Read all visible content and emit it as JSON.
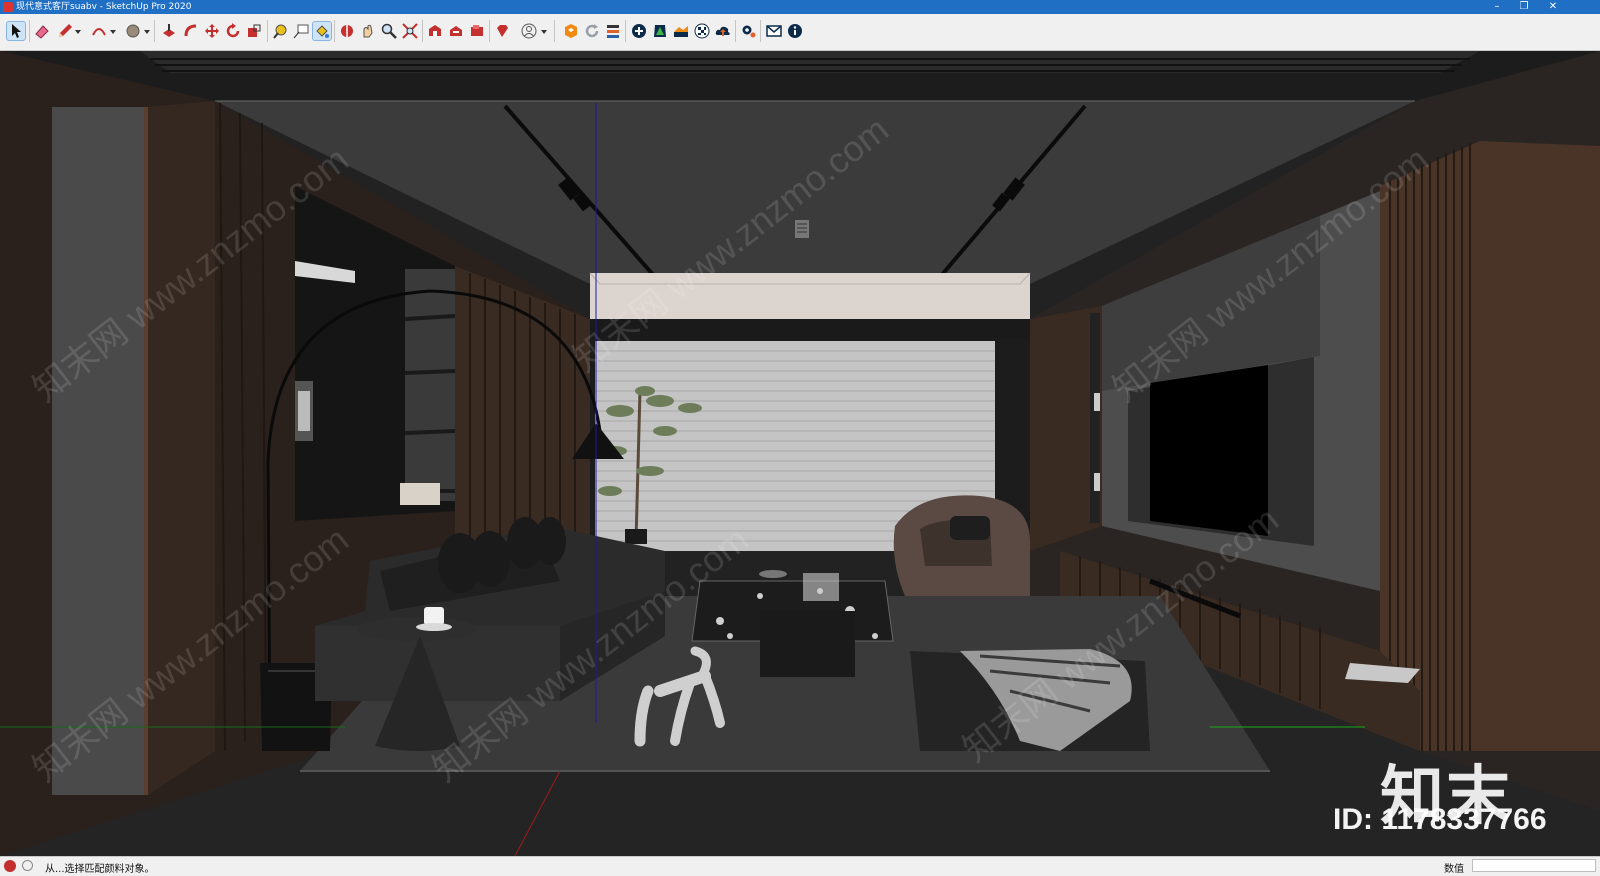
{
  "window": {
    "title": "现代意式客厅suabv - SketchUp Pro 2020",
    "minimize_glyph": "–",
    "restore_glyph": "❐",
    "close_glyph": "✕"
  },
  "toolbar": {
    "tools": [
      {
        "id": "select",
        "icon": "arrow-cursor-icon"
      },
      {
        "id": "eraser",
        "icon": "eraser-icon"
      },
      {
        "id": "line",
        "icon": "pencil-icon"
      },
      {
        "id": "arc",
        "icon": "arc-icon"
      },
      {
        "id": "shapes",
        "icon": "circle-icon"
      },
      {
        "id": "push-pull",
        "icon": "push-pull-icon"
      },
      {
        "id": "follow-me",
        "icon": "follow-me-icon"
      },
      {
        "id": "move",
        "icon": "move-icon"
      },
      {
        "id": "rotate",
        "icon": "rotate-icon"
      },
      {
        "id": "scale",
        "icon": "scale-icon"
      },
      {
        "id": "tape-measure",
        "icon": "tape-measure-icon"
      },
      {
        "id": "text",
        "icon": "text-icon"
      },
      {
        "id": "paint-bucket",
        "icon": "paint-bucket-icon"
      },
      {
        "id": "orbit",
        "icon": "orbit-icon"
      },
      {
        "id": "pan",
        "icon": "pan-icon"
      },
      {
        "id": "zoom",
        "icon": "zoom-icon"
      },
      {
        "id": "zoom-extents",
        "icon": "zoom-extents-icon"
      },
      {
        "id": "warehouse",
        "icon": "warehouse-icon"
      },
      {
        "id": "share-model",
        "icon": "share-model-icon"
      },
      {
        "id": "extension-warehouse",
        "icon": "extension-warehouse-icon"
      },
      {
        "id": "ruby",
        "icon": "ruby-icon"
      },
      {
        "id": "account",
        "icon": "user-icon"
      },
      {
        "id": "layout",
        "icon": "layout-icon"
      },
      {
        "id": "refresh",
        "icon": "refresh-icon"
      },
      {
        "id": "layers",
        "icon": "layers-icon"
      },
      {
        "id": "add",
        "icon": "add-icon"
      },
      {
        "id": "tree",
        "icon": "tree-icon"
      },
      {
        "id": "terrain",
        "icon": "terrain-icon"
      },
      {
        "id": "checker",
        "icon": "checker-icon"
      },
      {
        "id": "cloud-upload",
        "icon": "cloud-upload-icon"
      },
      {
        "id": "settings",
        "icon": "gear-icon"
      },
      {
        "id": "mail",
        "icon": "mail-icon"
      },
      {
        "id": "info",
        "icon": "info-icon"
      }
    ]
  },
  "statusbar": {
    "hint": "从...选择匹配颜料对象。",
    "measure_label": "数值",
    "measure_value": ""
  },
  "watermark": {
    "logo_text": "知末",
    "id_text": "ID: 1178337766",
    "diagonal_text": "知末网 www.znzmo.com"
  },
  "colors": {
    "titlebar": "#1f6fc5",
    "wood": "#3a2a20",
    "ceiling": "#3a3a3a",
    "wall_gray": "#4a4a4a"
  }
}
